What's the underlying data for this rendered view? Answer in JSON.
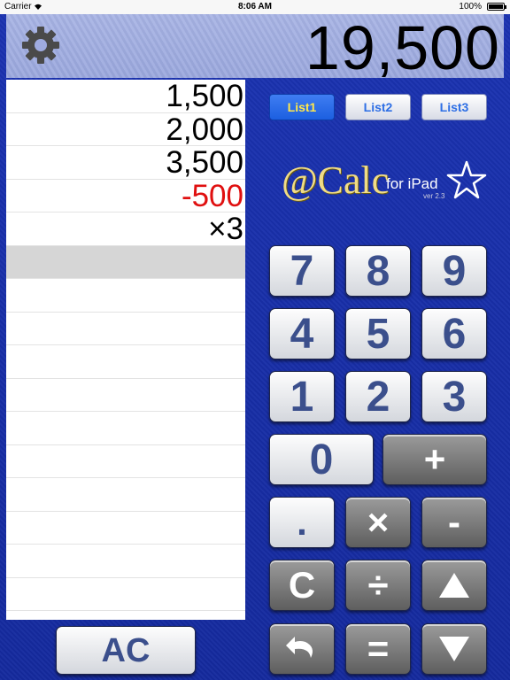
{
  "status_bar": {
    "carrier": "Carrier",
    "time": "8:06 AM",
    "battery": "100%"
  },
  "display": {
    "value": "19,500"
  },
  "tape": {
    "rows": [
      {
        "text": "1,500",
        "negative": false
      },
      {
        "text": "2,000",
        "negative": false
      },
      {
        "text": "3,500",
        "negative": false
      },
      {
        "text": "-500",
        "negative": true
      },
      {
        "text": "×3",
        "negative": false
      }
    ],
    "active_row_index": 5,
    "total_rows": 16
  },
  "tabs": [
    {
      "label": "List1",
      "selected": true
    },
    {
      "label": "List2",
      "selected": false
    },
    {
      "label": "List3",
      "selected": false
    }
  ],
  "logo": {
    "main": "@Calc",
    "for": "for iPad",
    "version": "ver 2.3"
  },
  "keys": {
    "k7": "7",
    "k8": "8",
    "k9": "9",
    "k4": "4",
    "k5": "5",
    "k6": "6",
    "k1": "1",
    "k2": "2",
    "k3": "3",
    "k0": "0",
    "plus": "+",
    "dot": ".",
    "times": "×",
    "minus": "-",
    "clear": "C",
    "divide": "÷",
    "equals": "=",
    "all_clear": "AC"
  },
  "icons": {
    "settings": "gear-icon",
    "undo": "undo-icon",
    "up": "arrow-up-icon",
    "down": "arrow-down-icon",
    "wifi": "wifi-icon",
    "battery": "battery-icon",
    "logo_star": "star-icon"
  },
  "colors": {
    "background": "#1a2ea8",
    "display": "#9aa7dd",
    "negative": "#e01010",
    "tab_selected_text": "#ffe84a",
    "logo_gold": "#f0dc86"
  }
}
